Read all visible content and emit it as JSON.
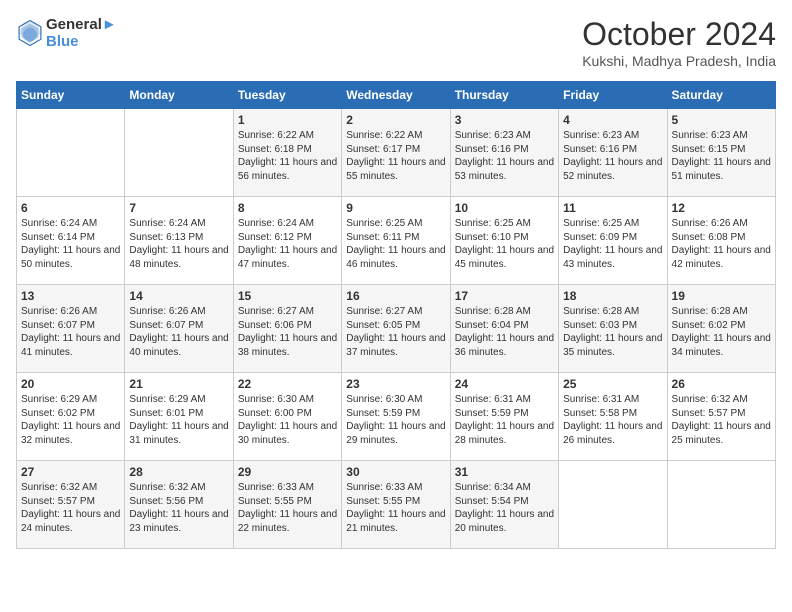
{
  "logo": {
    "line1": "General",
    "line2": "Blue"
  },
  "title": "October 2024",
  "location": "Kukshi, Madhya Pradesh, India",
  "days_header": [
    "Sunday",
    "Monday",
    "Tuesday",
    "Wednesday",
    "Thursday",
    "Friday",
    "Saturday"
  ],
  "weeks": [
    [
      {
        "day": "",
        "sunrise": "",
        "sunset": "",
        "daylight": ""
      },
      {
        "day": "",
        "sunrise": "",
        "sunset": "",
        "daylight": ""
      },
      {
        "day": "1",
        "sunrise": "Sunrise: 6:22 AM",
        "sunset": "Sunset: 6:18 PM",
        "daylight": "Daylight: 11 hours and 56 minutes."
      },
      {
        "day": "2",
        "sunrise": "Sunrise: 6:22 AM",
        "sunset": "Sunset: 6:17 PM",
        "daylight": "Daylight: 11 hours and 55 minutes."
      },
      {
        "day": "3",
        "sunrise": "Sunrise: 6:23 AM",
        "sunset": "Sunset: 6:16 PM",
        "daylight": "Daylight: 11 hours and 53 minutes."
      },
      {
        "day": "4",
        "sunrise": "Sunrise: 6:23 AM",
        "sunset": "Sunset: 6:16 PM",
        "daylight": "Daylight: 11 hours and 52 minutes."
      },
      {
        "day": "5",
        "sunrise": "Sunrise: 6:23 AM",
        "sunset": "Sunset: 6:15 PM",
        "daylight": "Daylight: 11 hours and 51 minutes."
      }
    ],
    [
      {
        "day": "6",
        "sunrise": "Sunrise: 6:24 AM",
        "sunset": "Sunset: 6:14 PM",
        "daylight": "Daylight: 11 hours and 50 minutes."
      },
      {
        "day": "7",
        "sunrise": "Sunrise: 6:24 AM",
        "sunset": "Sunset: 6:13 PM",
        "daylight": "Daylight: 11 hours and 48 minutes."
      },
      {
        "day": "8",
        "sunrise": "Sunrise: 6:24 AM",
        "sunset": "Sunset: 6:12 PM",
        "daylight": "Daylight: 11 hours and 47 minutes."
      },
      {
        "day": "9",
        "sunrise": "Sunrise: 6:25 AM",
        "sunset": "Sunset: 6:11 PM",
        "daylight": "Daylight: 11 hours and 46 minutes."
      },
      {
        "day": "10",
        "sunrise": "Sunrise: 6:25 AM",
        "sunset": "Sunset: 6:10 PM",
        "daylight": "Daylight: 11 hours and 45 minutes."
      },
      {
        "day": "11",
        "sunrise": "Sunrise: 6:25 AM",
        "sunset": "Sunset: 6:09 PM",
        "daylight": "Daylight: 11 hours and 43 minutes."
      },
      {
        "day": "12",
        "sunrise": "Sunrise: 6:26 AM",
        "sunset": "Sunset: 6:08 PM",
        "daylight": "Daylight: 11 hours and 42 minutes."
      }
    ],
    [
      {
        "day": "13",
        "sunrise": "Sunrise: 6:26 AM",
        "sunset": "Sunset: 6:07 PM",
        "daylight": "Daylight: 11 hours and 41 minutes."
      },
      {
        "day": "14",
        "sunrise": "Sunrise: 6:26 AM",
        "sunset": "Sunset: 6:07 PM",
        "daylight": "Daylight: 11 hours and 40 minutes."
      },
      {
        "day": "15",
        "sunrise": "Sunrise: 6:27 AM",
        "sunset": "Sunset: 6:06 PM",
        "daylight": "Daylight: 11 hours and 38 minutes."
      },
      {
        "day": "16",
        "sunrise": "Sunrise: 6:27 AM",
        "sunset": "Sunset: 6:05 PM",
        "daylight": "Daylight: 11 hours and 37 minutes."
      },
      {
        "day": "17",
        "sunrise": "Sunrise: 6:28 AM",
        "sunset": "Sunset: 6:04 PM",
        "daylight": "Daylight: 11 hours and 36 minutes."
      },
      {
        "day": "18",
        "sunrise": "Sunrise: 6:28 AM",
        "sunset": "Sunset: 6:03 PM",
        "daylight": "Daylight: 11 hours and 35 minutes."
      },
      {
        "day": "19",
        "sunrise": "Sunrise: 6:28 AM",
        "sunset": "Sunset: 6:02 PM",
        "daylight": "Daylight: 11 hours and 34 minutes."
      }
    ],
    [
      {
        "day": "20",
        "sunrise": "Sunrise: 6:29 AM",
        "sunset": "Sunset: 6:02 PM",
        "daylight": "Daylight: 11 hours and 32 minutes."
      },
      {
        "day": "21",
        "sunrise": "Sunrise: 6:29 AM",
        "sunset": "Sunset: 6:01 PM",
        "daylight": "Daylight: 11 hours and 31 minutes."
      },
      {
        "day": "22",
        "sunrise": "Sunrise: 6:30 AM",
        "sunset": "Sunset: 6:00 PM",
        "daylight": "Daylight: 11 hours and 30 minutes."
      },
      {
        "day": "23",
        "sunrise": "Sunrise: 6:30 AM",
        "sunset": "Sunset: 5:59 PM",
        "daylight": "Daylight: 11 hours and 29 minutes."
      },
      {
        "day": "24",
        "sunrise": "Sunrise: 6:31 AM",
        "sunset": "Sunset: 5:59 PM",
        "daylight": "Daylight: 11 hours and 28 minutes."
      },
      {
        "day": "25",
        "sunrise": "Sunrise: 6:31 AM",
        "sunset": "Sunset: 5:58 PM",
        "daylight": "Daylight: 11 hours and 26 minutes."
      },
      {
        "day": "26",
        "sunrise": "Sunrise: 6:32 AM",
        "sunset": "Sunset: 5:57 PM",
        "daylight": "Daylight: 11 hours and 25 minutes."
      }
    ],
    [
      {
        "day": "27",
        "sunrise": "Sunrise: 6:32 AM",
        "sunset": "Sunset: 5:57 PM",
        "daylight": "Daylight: 11 hours and 24 minutes."
      },
      {
        "day": "28",
        "sunrise": "Sunrise: 6:32 AM",
        "sunset": "Sunset: 5:56 PM",
        "daylight": "Daylight: 11 hours and 23 minutes."
      },
      {
        "day": "29",
        "sunrise": "Sunrise: 6:33 AM",
        "sunset": "Sunset: 5:55 PM",
        "daylight": "Daylight: 11 hours and 22 minutes."
      },
      {
        "day": "30",
        "sunrise": "Sunrise: 6:33 AM",
        "sunset": "Sunset: 5:55 PM",
        "daylight": "Daylight: 11 hours and 21 minutes."
      },
      {
        "day": "31",
        "sunrise": "Sunrise: 6:34 AM",
        "sunset": "Sunset: 5:54 PM",
        "daylight": "Daylight: 11 hours and 20 minutes."
      },
      {
        "day": "",
        "sunrise": "",
        "sunset": "",
        "daylight": ""
      },
      {
        "day": "",
        "sunrise": "",
        "sunset": "",
        "daylight": ""
      }
    ]
  ]
}
